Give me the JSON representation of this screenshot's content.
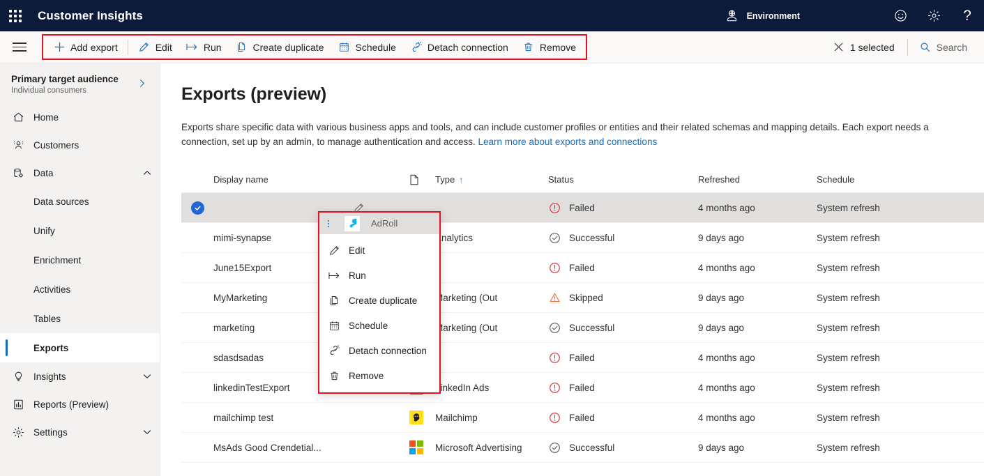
{
  "brand": {
    "waffle_icon": "app-launcher-icon",
    "title": "Customer Insights",
    "environment_label": "Environment",
    "environment_icon": "globe-people-icon",
    "feedback_icon": "smiley-icon",
    "settings_icon": "gear-icon",
    "help_icon": "question-mark-icon"
  },
  "commandbar": {
    "hamburger_icon": "hamburger-menu-icon",
    "items": [
      {
        "label": "Add export",
        "icon": "plus-icon"
      },
      {
        "label": "Edit",
        "icon": "pencil-icon"
      },
      {
        "label": "Run",
        "icon": "run-arrow-icon"
      },
      {
        "label": "Create duplicate",
        "icon": "copy-pages-icon"
      },
      {
        "label": "Schedule",
        "icon": "calendar-icon"
      },
      {
        "label": "Detach connection",
        "icon": "broken-link-icon"
      },
      {
        "label": "Remove",
        "icon": "trash-icon"
      }
    ],
    "selected_label": "1 selected",
    "selected_icon": "close-x-icon",
    "search_label": "Search",
    "search_icon": "search-icon",
    "highlight_color": "#e81123"
  },
  "sidebar": {
    "audience": {
      "title": "Primary target audience",
      "subtitle": "Individual consumers",
      "chevron": "chevron-right-icon"
    },
    "items": [
      {
        "label": "Home",
        "icon": "home-icon",
        "type": "item"
      },
      {
        "label": "Customers",
        "icon": "people-icon",
        "type": "item"
      },
      {
        "label": "Data",
        "icon": "database-gear-icon",
        "type": "group",
        "chevron": "chevron-up-icon",
        "expanded": true
      },
      {
        "label": "Data sources",
        "type": "sub"
      },
      {
        "label": "Unify",
        "type": "sub"
      },
      {
        "label": "Enrichment",
        "type": "sub"
      },
      {
        "label": "Activities",
        "type": "sub"
      },
      {
        "label": "Tables",
        "type": "sub"
      },
      {
        "label": "Exports",
        "type": "sub",
        "selected": true
      },
      {
        "label": "Insights",
        "icon": "lightbulb-icon",
        "type": "group",
        "chevron": "chevron-down-icon"
      },
      {
        "label": "Reports (Preview)",
        "icon": "report-chart-icon",
        "type": "item"
      },
      {
        "label": "Settings",
        "icon": "gear-icon",
        "type": "group",
        "chevron": "chevron-down-icon"
      }
    ]
  },
  "page": {
    "title": "Exports (preview)",
    "description_part1": "Exports share specific data with various business apps and tools, and can include customer profiles or entities and their related schemas and mapping details. Each export needs a connection, set up by an admin, to manage authentication and access. ",
    "description_link": "Learn more about exports and connections"
  },
  "table": {
    "headers": {
      "display_name": "Display name",
      "type": "Type",
      "type_icon": "page-icon",
      "type_sort": "↑",
      "status": "Status",
      "refreshed": "Refreshed",
      "schedule": "Schedule"
    },
    "rows": [
      {
        "name": "",
        "name_redacted": true,
        "selected": true,
        "type": "AdRoll",
        "type_icon": "adroll-logo",
        "status": "Failed",
        "status_icon": "error-circle-icon",
        "refreshed": "4 months ago",
        "schedule": "System refresh"
      },
      {
        "name": "mimi-synapse",
        "selected": false,
        "type": "Analytics",
        "type_icon": "analytics-logo",
        "status": "Successful",
        "status_icon": "check-circle-icon",
        "refreshed": "9 days ago",
        "schedule": "System refresh"
      },
      {
        "name": "June15Export",
        "selected": false,
        "type": "",
        "type_icon": "",
        "status": "Failed",
        "status_icon": "error-circle-icon",
        "refreshed": "4 months ago",
        "schedule": "System refresh"
      },
      {
        "name": "MyMarketing",
        "selected": false,
        "type": "Marketing (Out",
        "type_icon": "",
        "status": "Skipped",
        "status_icon": "warning-triangle-icon",
        "refreshed": "9 days ago",
        "schedule": "System refresh"
      },
      {
        "name": "marketing",
        "selected": false,
        "type": "Marketing (Out",
        "type_icon": "",
        "status": "Successful",
        "status_icon": "check-circle-icon",
        "refreshed": "9 days ago",
        "schedule": "System refresh"
      },
      {
        "name": "sdasdsadas",
        "selected": false,
        "type": "",
        "type_icon": "",
        "status": "Failed",
        "status_icon": "error-circle-icon",
        "refreshed": "4 months ago",
        "schedule": "System refresh"
      },
      {
        "name": "linkedinTestExport",
        "selected": false,
        "type": "LinkedIn Ads",
        "type_icon": "linkedin-logo",
        "status": "Failed",
        "status_icon": "error-circle-icon",
        "refreshed": "4 months ago",
        "schedule": "System refresh"
      },
      {
        "name": "mailchimp test",
        "selected": false,
        "type": "Mailchimp",
        "type_icon": "mailchimp-logo",
        "status": "Failed",
        "status_icon": "error-circle-icon",
        "refreshed": "4 months ago",
        "schedule": "System refresh"
      },
      {
        "name": "MsAds Good Crendetial...",
        "selected": false,
        "type": "Microsoft Advertising",
        "type_icon": "microsoft-logo",
        "status": "Successful",
        "status_icon": "check-circle-icon",
        "refreshed": "9 days ago",
        "schedule": "System refresh"
      }
    ]
  },
  "context_menu": {
    "kebab_icon": "more-vertical-icon",
    "header_label": "AdRoll",
    "header_icon": "adroll-logo",
    "items": [
      {
        "label": "Edit",
        "icon": "pencil-icon"
      },
      {
        "label": "Run",
        "icon": "run-arrow-icon"
      },
      {
        "label": "Create duplicate",
        "icon": "copy-pages-icon"
      },
      {
        "label": "Schedule",
        "icon": "calendar-icon"
      },
      {
        "label": "Detach connection",
        "icon": "broken-link-icon"
      },
      {
        "label": "Remove",
        "icon": "trash-icon"
      }
    ],
    "border_color": "#e81123"
  },
  "colors": {
    "brandbar_bg": "#0b1b39",
    "accent_blue": "#0f6cbd",
    "selected_row_bg": "#e1dfdd",
    "error_red": "#d13438",
    "warning_orange": "#e8703a",
    "highlight_red": "#e81123"
  }
}
